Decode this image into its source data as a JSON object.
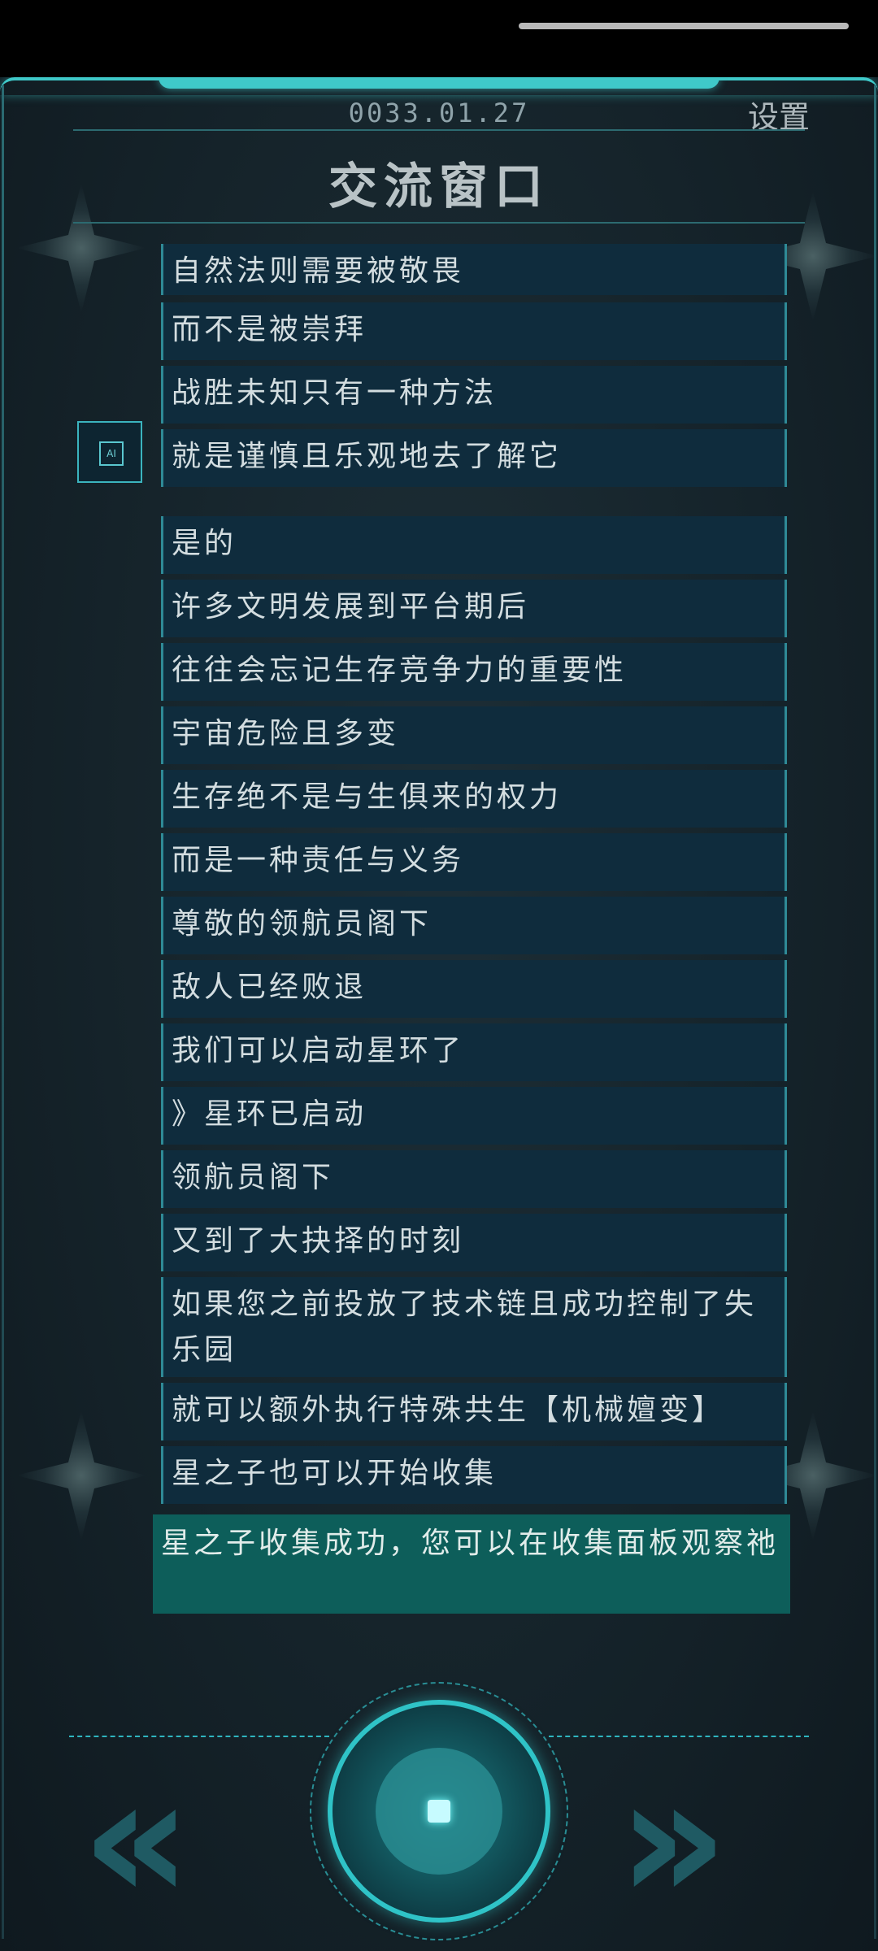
{
  "header": {
    "date": "0033.01.27",
    "settings_label": "设置",
    "title": "交流窗口"
  },
  "messages": [
    "自然法则需要被敬畏",
    "而不是被崇拜",
    "战胜未知只有一种方法",
    "就是谨慎且乐观地去了解它",
    "是的",
    "许多文明发展到平台期后",
    "往往会忘记生存竞争力的重要性",
    "宇宙危险且多变",
    "生存绝不是与生俱来的权力",
    "而是一种责任与义务",
    "尊敬的领航员阁下",
    "敌人已经败退",
    "我们可以启动星环了",
    "》星环已启动",
    "领航员阁下",
    "又到了大抉择的时刻",
    "如果您之前投放了技术链且成功控制了失乐园",
    "就可以额外执行特殊共生【机械嬗变】",
    "星之子也可以开始收集",
    "星之子收集成功，您可以在收集面板观察祂"
  ],
  "ai_icon_label": "AI",
  "controls": {
    "prev_label": "«",
    "next_label": "»"
  },
  "colors": {
    "accent": "#3fc9c9",
    "message_bg": "#0f2c3d",
    "highlight_bg": "#0d5e5a"
  }
}
